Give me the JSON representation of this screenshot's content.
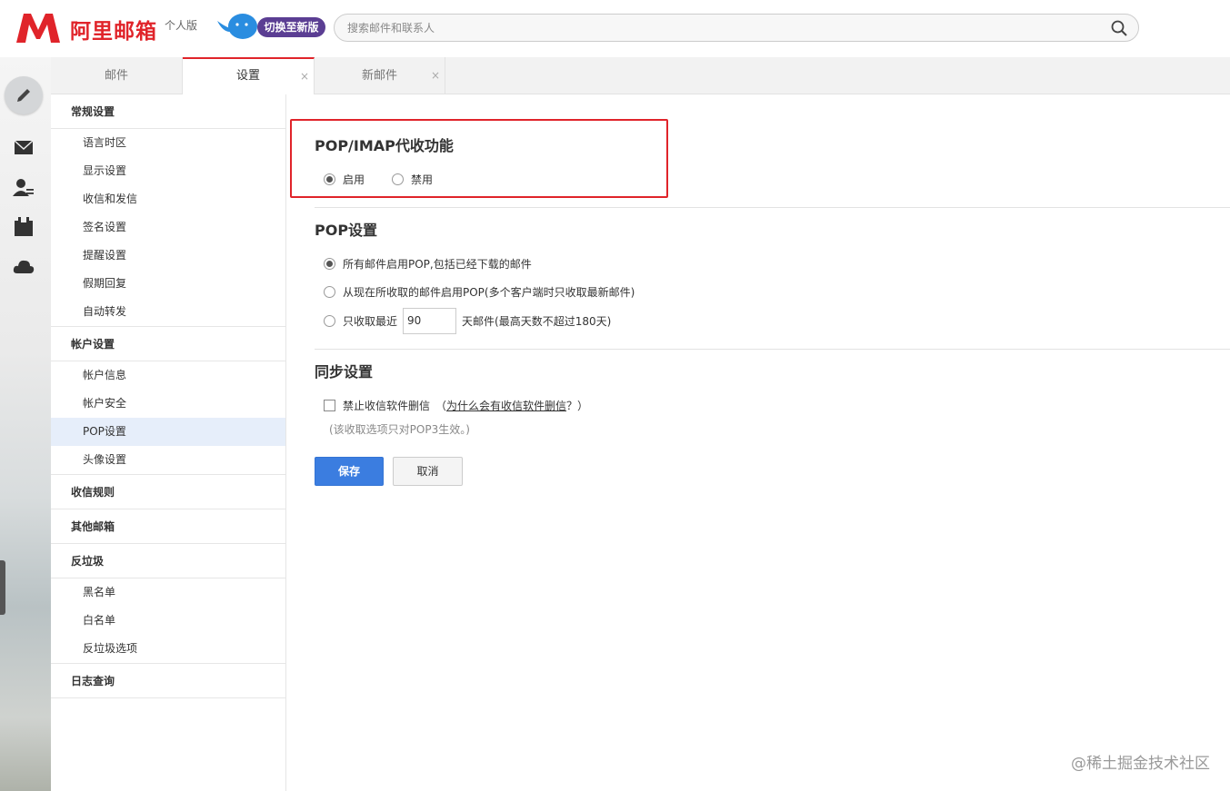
{
  "header": {
    "brand": "阿里邮箱",
    "edition": "个人版",
    "switch_label": "切换至新版",
    "search_placeholder": "搜索邮件和联系人"
  },
  "tabs": [
    {
      "label": "邮件"
    },
    {
      "label": "设置",
      "close": "×"
    },
    {
      "label": "新邮件",
      "close": "×"
    }
  ],
  "nav": {
    "general": "常规设置",
    "general_items": [
      "语言时区",
      "显示设置",
      "收信和发信",
      "签名设置",
      "提醒设置",
      "假期回复",
      "自动转发"
    ],
    "account": "帐户设置",
    "account_items": [
      "帐户信息",
      "帐户安全",
      "POP设置",
      "头像设置"
    ],
    "rules": "收信规则",
    "other": "其他邮箱",
    "spam": "反垃圾",
    "spam_items": [
      "黑名单",
      "白名单",
      "反垃圾选项"
    ],
    "log": "日志查询"
  },
  "main": {
    "popimap_title": "POP/IMAP代收功能",
    "enable": "启用",
    "disable": "禁用",
    "pop_title": "POP设置",
    "pop_opt1": "所有邮件启用POP,包括已经下载的邮件",
    "pop_opt2": "从现在所收取的邮件启用POP(多个客户端时只收取最新邮件)",
    "pop_opt3_pre": "只收取最近",
    "pop_days": "90",
    "pop_opt3_post": "天邮件(最高天数不超过180天)",
    "sync_title": "同步设置",
    "sync_opt": "禁止收信软件删信",
    "sync_paren_open": "（",
    "sync_link": "为什么会有收信软件删信",
    "sync_paren_close": "？）",
    "sync_hint": "(该收取选项只对POP3生效。)",
    "save": "保存",
    "cancel": "取消"
  },
  "watermark": "@稀土掘金技术社区",
  "colors": {
    "brand_red": "#e0242a",
    "primary_blue": "#3b7de0",
    "switch_purple": "#5b3e93"
  }
}
